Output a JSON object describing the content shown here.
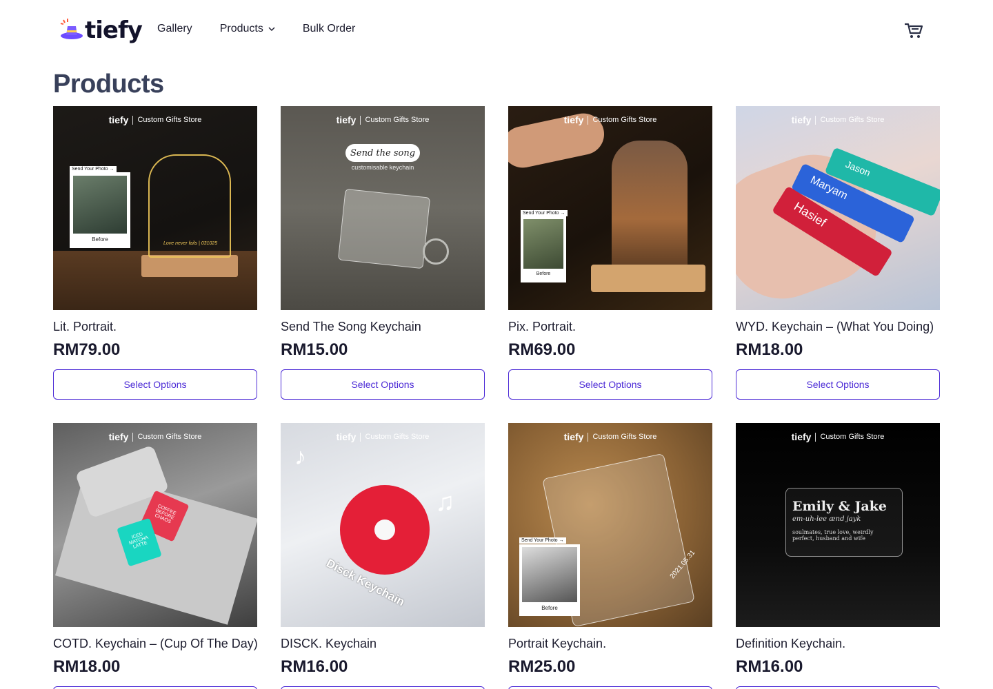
{
  "brand": {
    "wordmark": "tiefy",
    "accent": "#5b3df0",
    "hat": "#6d4cff",
    "spark": "#ff5a3c"
  },
  "nav": {
    "gallery": "Gallery",
    "products": "Products",
    "bulk": "Bulk Order",
    "products_icon": "chevron-down-icon",
    "cart_icon": "cart-icon"
  },
  "page": {
    "title": "Products"
  },
  "thumb_brand": {
    "name": "tiefy",
    "tag": "Custom Gifts Store"
  },
  "thumb_texts": {
    "send_photo": "Send Your Photo →",
    "before": "Before",
    "send_song": "Send the song",
    "song_sub": "customisable keychain",
    "disck": "Disck Keychain",
    "emily": "Emily & Jake",
    "emily_phon": "em-uh-lee ænd jayk",
    "emily_def": "soulmates, true love, weirdly perfect, husband and wife",
    "hasief": "Hasief",
    "maryam": "Maryam",
    "jason": "Jason",
    "coffee1": "COFFEE BEFORE CHAOS",
    "coffee2": "ICED MATCHA LATTE",
    "date": "2021.05.31",
    "love": "Love never fails | 031025"
  },
  "button_label": "Select Options",
  "products": [
    {
      "name": "Lit. Portrait.",
      "price": "RM79.00"
    },
    {
      "name": "Send The Song Keychain",
      "price": "RM15.00"
    },
    {
      "name": "Pix. Portrait.",
      "price": "RM69.00"
    },
    {
      "name": "WYD. Keychain – (What You Doing)",
      "price": "RM18.00"
    },
    {
      "name": "COTD. Keychain – (Cup Of The Day)",
      "price": "RM18.00"
    },
    {
      "name": "DISCK. Keychain",
      "price": "RM16.00"
    },
    {
      "name": "Portrait Keychain.",
      "price": "RM25.00"
    },
    {
      "name": "Definition Keychain.",
      "price": "RM16.00"
    }
  ]
}
